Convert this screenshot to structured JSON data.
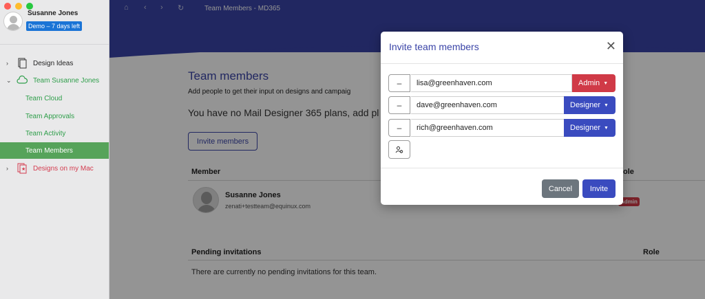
{
  "sidebar": {
    "user_name": "Susanne Jones",
    "demo_badge": "Demo – 7 days left",
    "items": [
      {
        "label": "Design Ideas"
      },
      {
        "label": "Team Susanne Jones"
      },
      {
        "label": "Team Cloud"
      },
      {
        "label": "Team Approvals"
      },
      {
        "label": "Team Activity"
      },
      {
        "label": "Team Members"
      },
      {
        "label": "Designs on my Mac"
      }
    ]
  },
  "titlebar": {
    "title": "Team Members - MD365"
  },
  "main": {
    "title": "Team members",
    "description": "Add people to get their input on designs and campaig",
    "plans_notice": "You have no Mail Designer 365 plans, add pl",
    "invite_members_label": "Invite members",
    "members_table": {
      "col_member": "Member",
      "col_role": "ole",
      "rows": [
        {
          "name": "Susanne Jones",
          "email": "zenati+testteam@equinux.com",
          "role": "Admin"
        }
      ]
    },
    "pending": {
      "col_title": "Pending invitations",
      "col_role": "Role",
      "empty_text": "There are currently no pending invitations for this team."
    }
  },
  "modal": {
    "title": "Invite team members",
    "remove_label": "–",
    "rows": [
      {
        "email": "lisa@greenhaven.com",
        "role": "Admin"
      },
      {
        "email": "dave@greenhaven.com",
        "role": "Designer"
      },
      {
        "email": "rich@greenhaven.com",
        "role": "Designer"
      }
    ],
    "cancel_label": "Cancel",
    "invite_label": "Invite"
  },
  "colors": {
    "brand": "#3a44a7",
    "admin": "#d03a47",
    "designer": "#3a4bbf",
    "active_nav": "#56a35a"
  }
}
